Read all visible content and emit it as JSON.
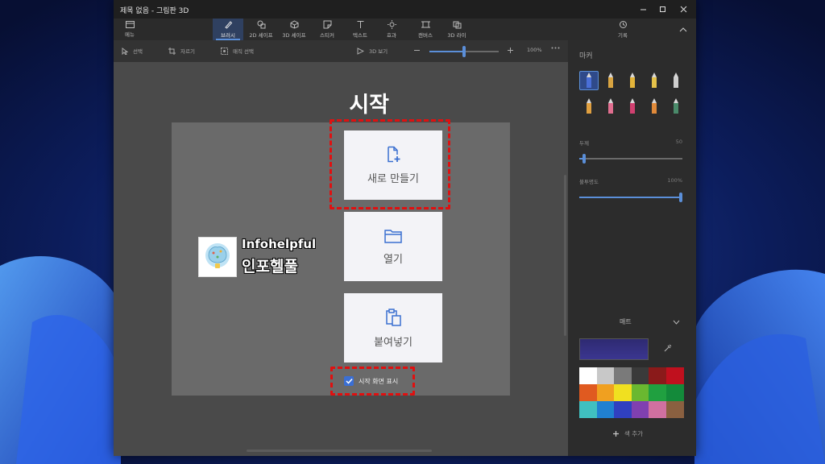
{
  "window": {
    "title": "제목 없음 - 그림판 3D"
  },
  "ribbon": {
    "menu_label": "메뉴",
    "tabs": [
      {
        "label": "브러시",
        "icon": "brush-icon",
        "active": true
      },
      {
        "label": "2D 셰이프",
        "icon": "shape-2d-icon",
        "active": false
      },
      {
        "label": "3D 셰이프",
        "icon": "cube-icon",
        "active": false
      },
      {
        "label": "스티커",
        "icon": "sticker-icon",
        "active": false
      },
      {
        "label": "텍스트",
        "icon": "text-icon",
        "active": false
      },
      {
        "label": "효과",
        "icon": "sun-icon",
        "active": false
      },
      {
        "label": "캔버스",
        "icon": "canvas-icon",
        "active": false
      },
      {
        "label": "3D 라이",
        "icon": "library-icon",
        "active": false
      }
    ],
    "history_label": "기록"
  },
  "toolbar": {
    "select_label": "선택",
    "crop_label": "자르기",
    "magic_select_label": "매직 선택",
    "view_3d_label": "3D 보기",
    "zoom_level": "100%",
    "zoom_fraction": 0.5
  },
  "start": {
    "title": "시작",
    "new_label": "새로 만들기",
    "open_label": "열기",
    "paste_label": "붙여넣기",
    "show_start_label": "시작 화면 표시",
    "show_start_checked": true
  },
  "logo": {
    "text_en": "Infohelpful",
    "text_ko": "인포헬풀"
  },
  "panel": {
    "title": "마커",
    "thickness_label": "두께",
    "thickness_value": "50",
    "thickness_fraction": 0.05,
    "opacity_label": "불투명도",
    "opacity_value": "100%",
    "opacity_fraction": 1.0,
    "finish_label": "매트",
    "current_color": "#2e2a72",
    "add_color_label": "색 추가",
    "brushes": [
      {
        "name": "marker-brush-icon",
        "color": "#4a6fd8",
        "active": true
      },
      {
        "name": "calligraphy-pen-icon",
        "color": "#d9a441"
      },
      {
        "name": "oil-brush-icon",
        "color": "#e3b43a"
      },
      {
        "name": "watercolor-brush-icon",
        "color": "#e5c24a"
      },
      {
        "name": "pixel-pen-icon",
        "color": "#cfcfcf"
      },
      {
        "name": "pencil-icon",
        "color": "#e0a040"
      },
      {
        "name": "eraser-icon",
        "color": "#e06e8f"
      },
      {
        "name": "crayon-icon",
        "color": "#d04070"
      },
      {
        "name": "spray-can-icon",
        "color": "#e08a3a"
      },
      {
        "name": "fill-icon",
        "color": "#4a8a6a"
      }
    ],
    "palette": [
      "#ffffff",
      "#c8c8c8",
      "#7a7a7a",
      "#3a3a3a",
      "#8a1a1a",
      "#c0101e",
      "#e05a20",
      "#f0a020",
      "#f0e020",
      "#6ab830",
      "#20a040",
      "#138a3a",
      "#40c0c0",
      "#2080d0",
      "#3040c0",
      "#8040b0",
      "#d070a0",
      "#8a6040"
    ]
  }
}
